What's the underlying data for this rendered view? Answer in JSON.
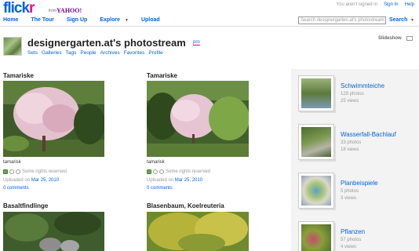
{
  "header": {
    "logo_left": "flick",
    "logo_right": "r",
    "from": "from",
    "yahoo": "YAHOO!",
    "not_signed_in": "You aren't signed in",
    "sign_in": "Sign In",
    "help": "Help"
  },
  "nav": {
    "items": [
      "Home",
      "The Tour",
      "Sign Up",
      "Explore",
      "Upload"
    ]
  },
  "search": {
    "placeholder": "Search designergarten.at's photostream",
    "button": "Search"
  },
  "profile": {
    "title": "designergarten.at's photostream",
    "pro": "pro",
    "subnav": [
      "Sets",
      "Galleries",
      "Tags",
      "People",
      "Archives",
      "Favorites",
      "Profile"
    ],
    "slideshow": "Slideshow"
  },
  "photos": [
    {
      "title": "Tamariske",
      "caption": "tamarisk",
      "rights": "Some rights reserved",
      "uploaded": "Uploaded on",
      "date": "Mar 25, 2010",
      "comments": "0 comments"
    },
    {
      "title": "Tamariske",
      "caption": "tamarisk",
      "rights": "Some rights reserved",
      "uploaded": "Uploaded on",
      "date": "Mar 25, 2010",
      "comments": "0 comments"
    },
    {
      "title": "Basaltfindlinge"
    },
    {
      "title": "Blasenbaum, Koelreuteria"
    }
  ],
  "sets": [
    {
      "name": "Schwimmteiche",
      "count": "129 photos",
      "views": "25 views",
      "color": "#7c9a5a"
    },
    {
      "name": "Wasserfall-Bachlauf",
      "count": "33 photos",
      "views": "18 views",
      "color": "#5f7f45"
    },
    {
      "name": "Planbeispiele",
      "count": "5 photos",
      "views": "3 views",
      "color": "#8fb0c9"
    },
    {
      "name": "Pflanzen",
      "count": "57 photos",
      "views": "4 views",
      "color": "#8a9f3c"
    }
  ]
}
